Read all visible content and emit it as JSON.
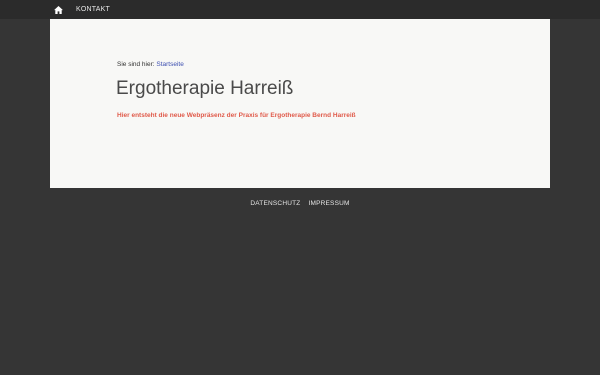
{
  "topnav": {
    "home_icon": "home-icon",
    "items": [
      {
        "label": "KONTAKT"
      }
    ]
  },
  "breadcrumb": {
    "prefix": "Sie sind hier:",
    "current": "Startseite"
  },
  "main": {
    "title": "Ergotherapie Harreiß",
    "tagline": "Hier entsteht die neue Webpräsenz der Praxis für Ergotherapie Bernd Harreiß"
  },
  "footer": {
    "links": [
      {
        "label": "DATENSCHUTZ"
      },
      {
        "label": "IMPRESSUM"
      }
    ]
  },
  "colors": {
    "background": "#353535",
    "topbar": "#2b2b2b",
    "content_bg": "#f8f8f6",
    "link": "#3d4fb0",
    "tagline": "#e05a4a"
  }
}
